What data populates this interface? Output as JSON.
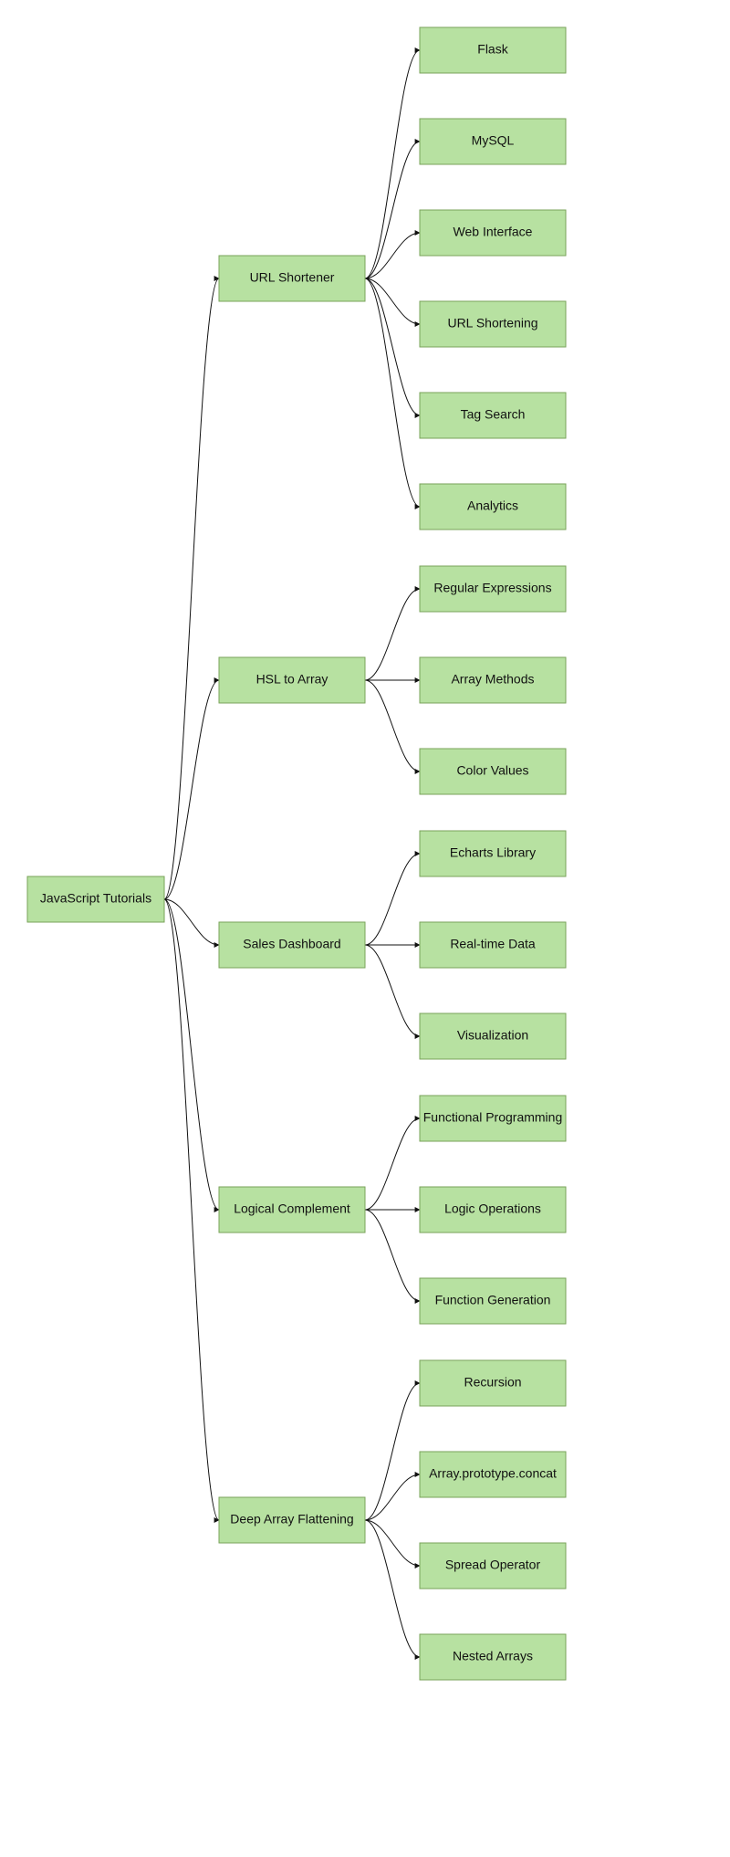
{
  "diagram": {
    "root": {
      "label": "JavaScript Tutorials"
    },
    "columns": {
      "col1": [
        {
          "id": "url-shortener",
          "label": "URL Shortener"
        },
        {
          "id": "hsl-to-array",
          "label": "HSL to Array"
        },
        {
          "id": "sales-dashboard",
          "label": "Sales Dashboard"
        },
        {
          "id": "logical-complement",
          "label": "Logical Complement"
        },
        {
          "id": "deep-array-flattening",
          "label": "Deep Array Flattening"
        }
      ],
      "col2": {
        "url-shortener": [
          "Flask",
          "MySQL",
          "Web Interface",
          "URL Shortening",
          "Tag Search",
          "Analytics"
        ],
        "hsl-to-array": [
          "Regular Expressions",
          "Array Methods",
          "Color Values"
        ],
        "sales-dashboard": [
          "Echarts Library",
          "Real-time Data",
          "Visualization"
        ],
        "logical-complement": [
          "Functional Programming",
          "Logic Operations",
          "Function Generation"
        ],
        "deep-array-flattening": [
          "Recursion",
          "Array.prototype.concat",
          "Spread Operator",
          "Nested Arrays"
        ]
      }
    }
  }
}
